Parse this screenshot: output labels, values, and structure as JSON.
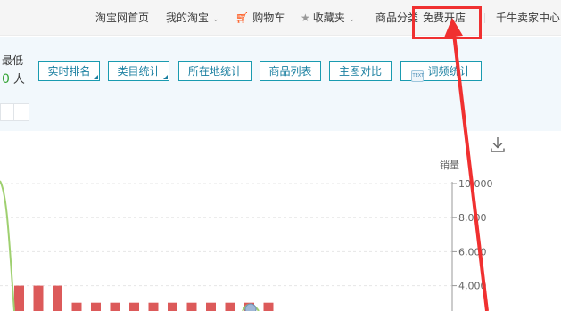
{
  "topbar": {
    "home": "淘宝网首页",
    "my_taobao": "我的淘宝",
    "cart": "购物车",
    "favorites": "收藏夹",
    "categories": "商品分类",
    "open_store": "免费开店",
    "seller_center": "千牛卖家中心"
  },
  "summary": {
    "lowest_label": "最低",
    "lowest_value": "0",
    "lowest_unit": "人"
  },
  "toolbar": {
    "buttons": [
      "实时排名",
      "类目统计",
      "所在地统计",
      "商品列表",
      "主图对比",
      "词频统计"
    ],
    "text_icon": "TEXT"
  },
  "colors": {
    "accent": "#1a9bb0",
    "bar": "#dc5a5a",
    "line": "#9fd070",
    "annotation": "#f03030"
  },
  "icons": {
    "cart": "cart-icon",
    "star": "star-icon",
    "download": "download-icon"
  },
  "chart_data": {
    "type": "bar",
    "ylabel": "销量",
    "ylim": [
      0,
      10000
    ],
    "y_ticks": [
      "2,000",
      "4,000",
      "6,000",
      "8,000",
      "10,000"
    ],
    "y_tick_values": [
      2000,
      4000,
      6000,
      8000,
      10000
    ],
    "values": [
      4000,
      4000,
      4000,
      3000,
      3000,
      3000,
      3000,
      3000,
      3000,
      3000,
      3000,
      3000,
      3000,
      3000,
      2000,
      2000,
      2000,
      2000,
      2000,
      2000,
      2000,
      2000
    ]
  }
}
